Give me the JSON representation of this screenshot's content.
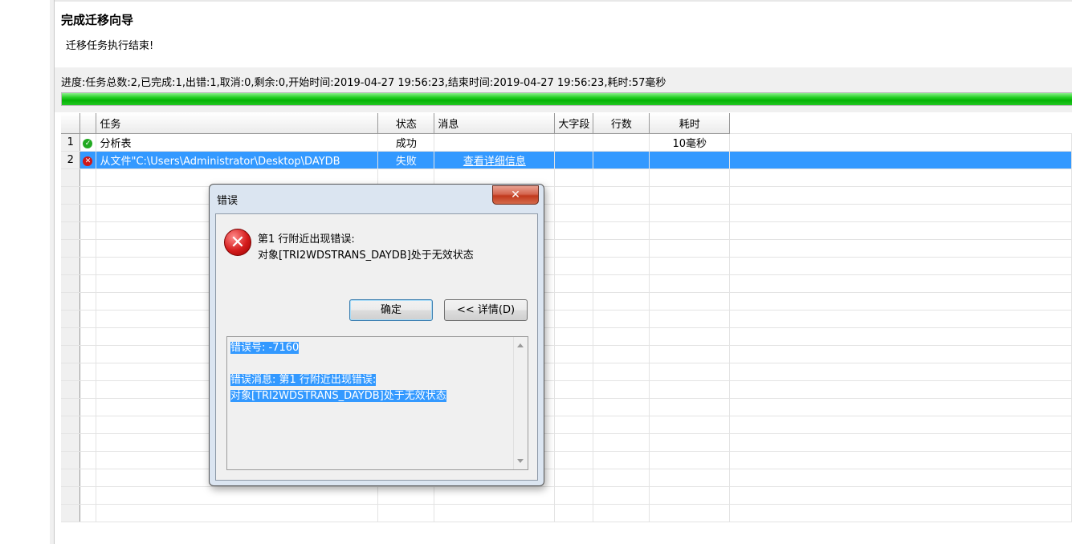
{
  "wizard": {
    "title": "完成迁移向导",
    "subtitle": "迁移任务执行结束!"
  },
  "progress": {
    "text": "进度:任务总数:2,已完成:1,出错:1,取消:0,剩余:0,开始时间:2019-04-27 19:56:23,结束时间:2019-04-27 19:56:23,耗时:57毫秒",
    "fill_percent": 100,
    "bar_color": "#22c822"
  },
  "grid": {
    "columns": [
      "任务",
      "状态",
      "消息",
      "大字段",
      "行数",
      "耗时"
    ],
    "rows": [
      {
        "num": "1",
        "icon": "success-check-icon",
        "task": "分析表",
        "status": "成功",
        "message": "",
        "lob": "",
        "rows": "",
        "time": "10毫秒"
      },
      {
        "num": "2",
        "icon": "error-x-icon",
        "task": "从文件\"C:\\Users\\Administrator\\Desktop\\DAYDB",
        "status": "失败",
        "message": "查看详细信息",
        "lob": "",
        "rows": "",
        "time": ""
      }
    ],
    "selected_color": "#3399ff"
  },
  "dialog": {
    "title": "错误",
    "close_glyph": "✕",
    "message_line1": "第1 行附近出现错误:",
    "message_line2": "对象[TRI2WDSTRANS_DAYDB]处于无效状态",
    "ok_label": "确定",
    "details_label": "<< 详情(D)",
    "detail_lines": [
      "错误号:  -7160",
      "",
      "错误消息: 第1 行附近出现错误:",
      "对象[TRI2WDSTRANS_DAYDB]处于无效状态"
    ]
  }
}
